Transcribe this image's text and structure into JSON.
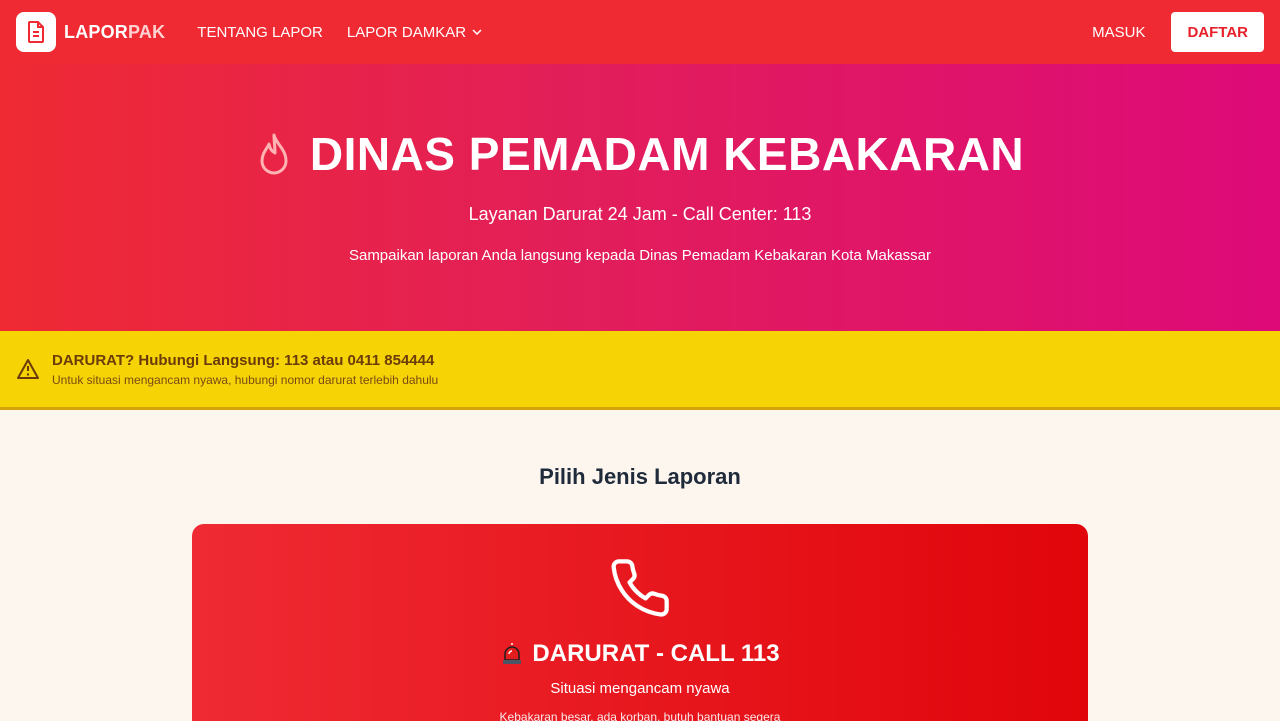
{
  "navbar": {
    "logo_part1": "LAPOR",
    "logo_part2": "PAK",
    "links": [
      "TENTANG LAPOR",
      "LAPOR DAMKAR"
    ],
    "login": "MASUK",
    "register": "DAFTAR"
  },
  "hero": {
    "title": "DINAS PEMADAM KEBAKARAN",
    "subtitle": "Layanan Darurat 24 Jam - Call Center: 113",
    "description": "Sampaikan laporan Anda langsung kepada Dinas Pemadam Kebakaran Kota Makassar"
  },
  "alert": {
    "title": "DARURAT? Hubungi Langsung: 113 atau 0411 854444",
    "text": "Untuk situasi mengancam nyawa, hubungi nomor darurat terlebih dahulu"
  },
  "section_title": "Pilih Jenis Laporan",
  "emergency_card": {
    "title": "DARURAT - CALL 113",
    "subtitle": "Situasi mengancam nyawa",
    "description": "Kebakaran besar, ada korban, butuh bantuan segera"
  },
  "colors": {
    "navbar": "#ef2a33",
    "hero_start": "#ef2a33",
    "hero_end": "#dd0a78",
    "alert": "#f6d304",
    "card": "#e0050a"
  },
  "icons": [
    "document-icon",
    "chevron-down-icon",
    "flame-icon",
    "warning-icon",
    "phone-icon",
    "siren-icon"
  ]
}
